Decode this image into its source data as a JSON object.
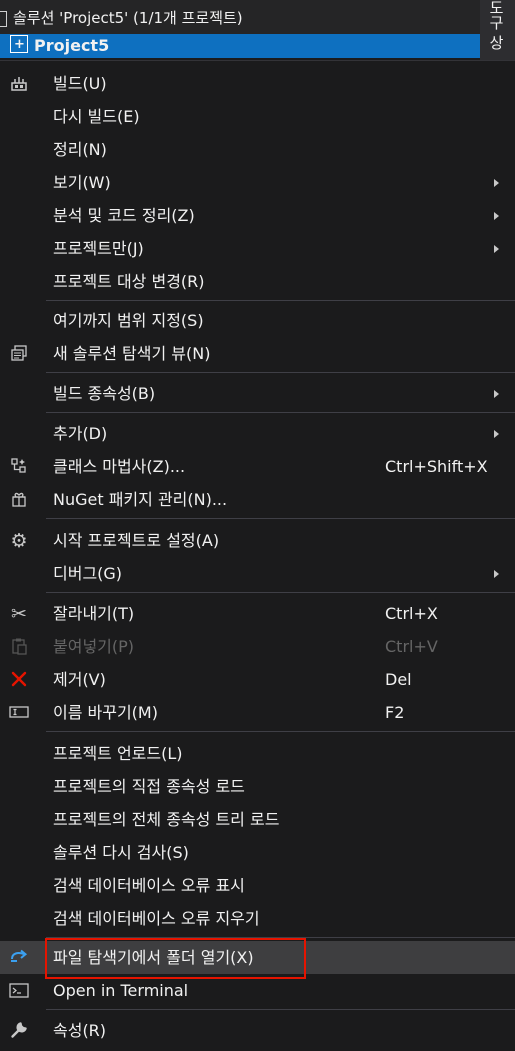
{
  "tree": {
    "solution_label": "솔루션 'Project5' (1/1개 프로젝트)",
    "project_label": "Project5",
    "side_tab": "도구 상"
  },
  "menu": {
    "items": [
      {
        "label": "빌드(U)",
        "icon": "build-icon"
      },
      {
        "label": "다시 빌드(E)"
      },
      {
        "label": "정리(N)"
      },
      {
        "label": "보기(W)",
        "submenu": true
      },
      {
        "label": "분석 및 코드 정리(Z)",
        "submenu": true
      },
      {
        "label": "프로젝트만(J)",
        "submenu": true
      },
      {
        "label": "프로젝트 대상 변경(R)"
      },
      {
        "label": "여기까지 범위 지정(S)"
      },
      {
        "label": "새 솔루션 탐색기 뷰(N)",
        "icon": "new-view-icon"
      },
      {
        "label": "빌드 종속성(B)",
        "submenu": true
      },
      {
        "label": "추가(D)",
        "submenu": true
      },
      {
        "label": "클래스 마법사(Z)...",
        "shortcut": "Ctrl+Shift+X",
        "icon": "class-wizard-icon"
      },
      {
        "label": "NuGet 패키지 관리(N)...",
        "icon": "nuget-icon"
      },
      {
        "label": "시작 프로젝트로 설정(A)",
        "icon": "gear-icon"
      },
      {
        "label": "디버그(G)",
        "submenu": true
      },
      {
        "label": "잘라내기(T)",
        "shortcut": "Ctrl+X",
        "icon": "scissors-icon"
      },
      {
        "label": "붙여넣기(P)",
        "shortcut": "Ctrl+V",
        "icon": "paste-icon",
        "disabled": true
      },
      {
        "label": "제거(V)",
        "shortcut": "Del",
        "icon": "delete-icon"
      },
      {
        "label": "이름 바꾸기(M)",
        "shortcut": "F2",
        "icon": "rename-icon"
      },
      {
        "label": "프로젝트 언로드(L)"
      },
      {
        "label": "프로젝트의 직접 종속성 로드"
      },
      {
        "label": "프로젝트의 전체 종속성 트리 로드"
      },
      {
        "label": "솔루션 다시 검사(S)"
      },
      {
        "label": "검색 데이터베이스 오류 표시"
      },
      {
        "label": "검색 데이터베이스 오류 지우기"
      },
      {
        "label": "파일 탐색기에서 폴더 열기(X)",
        "icon": "open-folder-icon",
        "hovered": true
      },
      {
        "label": "Open in Terminal",
        "icon": "terminal-icon"
      },
      {
        "label": "속성(R)",
        "icon": "wrench-icon"
      }
    ]
  },
  "colors": {
    "menu_bg": "#1b1b1c",
    "selection_bg": "#0e70c0",
    "hover_bg": "#3e3e40",
    "highlight_border": "#e51400",
    "delete_icon": "#e51400"
  }
}
